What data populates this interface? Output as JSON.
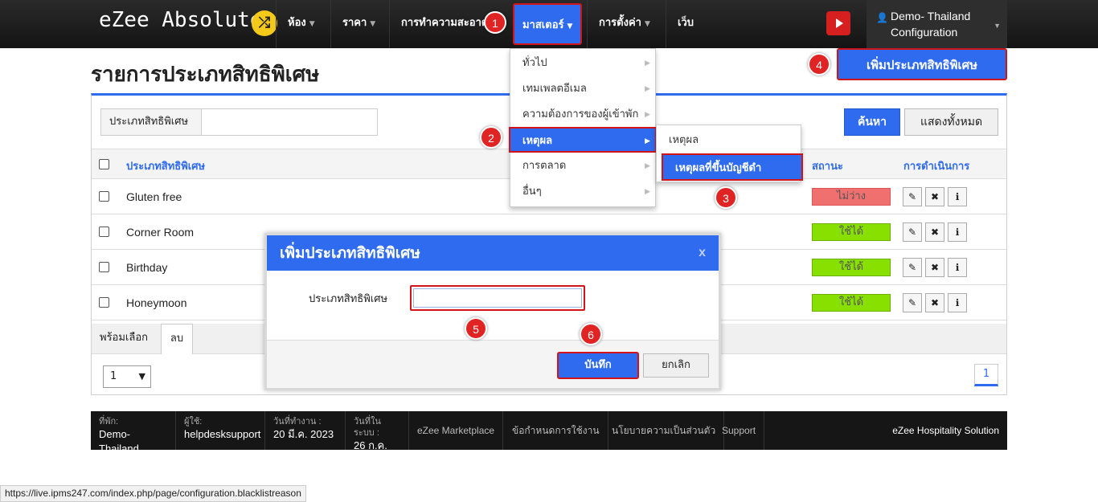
{
  "app": {
    "logo": "eZee Absolute",
    "logo_badge": "⤮"
  },
  "nav": {
    "items": [
      {
        "label": "ห้อง"
      },
      {
        "label": "ราคา"
      },
      {
        "label": "การทำความสะอาด"
      },
      {
        "label": "มาสเตอร์"
      },
      {
        "label": "การตั้งค่า"
      },
      {
        "label": "เว็บ"
      }
    ],
    "user_line1": "Demo- Thailand",
    "user_line2": "Configuration"
  },
  "page": {
    "title": "รายการประเภทสิทธิพิเศษ",
    "add_button": "เพิ่มประเภทสิทธิพิเศษ"
  },
  "filter": {
    "label": "ประเภทสิทธิพิเศษ",
    "value": "",
    "search_button": "ค้นหา",
    "show_all_button": "แสดงทั้งหมด"
  },
  "table": {
    "headers": {
      "name": "ประเภทสิทธิพิเศษ",
      "status": "สถานะ",
      "actions": "การดำเนินการ"
    },
    "rows": [
      {
        "name": "Gluten free",
        "status": "ไม่ว่าง",
        "status_color": "#f07070"
      },
      {
        "name": "Corner Room",
        "status": "ใช้ได้",
        "status_color": "#88e000"
      },
      {
        "name": "Birthday",
        "status": "ใช้ได้",
        "status_color": "#88e000"
      },
      {
        "name": "Honeymoon",
        "status": "ใช้ได้",
        "status_color": "#88e000"
      }
    ],
    "ready_label": "พร้อมเลือก",
    "delete_label": "ลบ",
    "page_size": "1",
    "current_page": "1"
  },
  "dropdown": {
    "items": [
      {
        "label": "ทั่วไป"
      },
      {
        "label": "เทมเพลตอีเมล"
      },
      {
        "label": "ความต้องการของผู้เข้าพัก"
      },
      {
        "label": "เหตุผล"
      },
      {
        "label": "การตลาด"
      },
      {
        "label": "อื่นๆ"
      }
    ],
    "submenu": [
      {
        "label": "เหตุผล"
      },
      {
        "label": "เหตุผลที่ขึ้นบัญชีดำ"
      }
    ]
  },
  "modal": {
    "title": "เพิ่มประเภทสิทธิพิเศษ",
    "close": "x",
    "field_label": "ประเภทสิทธิพิเศษ",
    "save_button": "บันทึก",
    "cancel_button": "ยกเลิก"
  },
  "markers": [
    "1",
    "2",
    "3",
    "4",
    "5",
    "6"
  ],
  "footer": {
    "property_label": "ที่พัก:",
    "property_value": "Demo- Thailand",
    "user_label": "ผู้ใช้:",
    "user_value": "helpdesksupport",
    "workday_label": "วันที่ทำงาน :",
    "workday_value": "20 มี.ค. 2023",
    "sysdate_label": "วันที่ในระบบ :",
    "sysdate_value": "26 ก.ค. 2023",
    "links": [
      "eZee Marketplace",
      "ข้อกำหนดการใช้งาน",
      "นโยบายความเป็นส่วนตัว",
      "Support"
    ],
    "brand": "eZee Hospitality Solution"
  },
  "status_url": "https://live.ipms247.com/index.php/page/configuration.blacklistreason",
  "colors": {
    "accent": "#2f6bef",
    "highlight": "#d0141a",
    "marker": "#e02424"
  }
}
